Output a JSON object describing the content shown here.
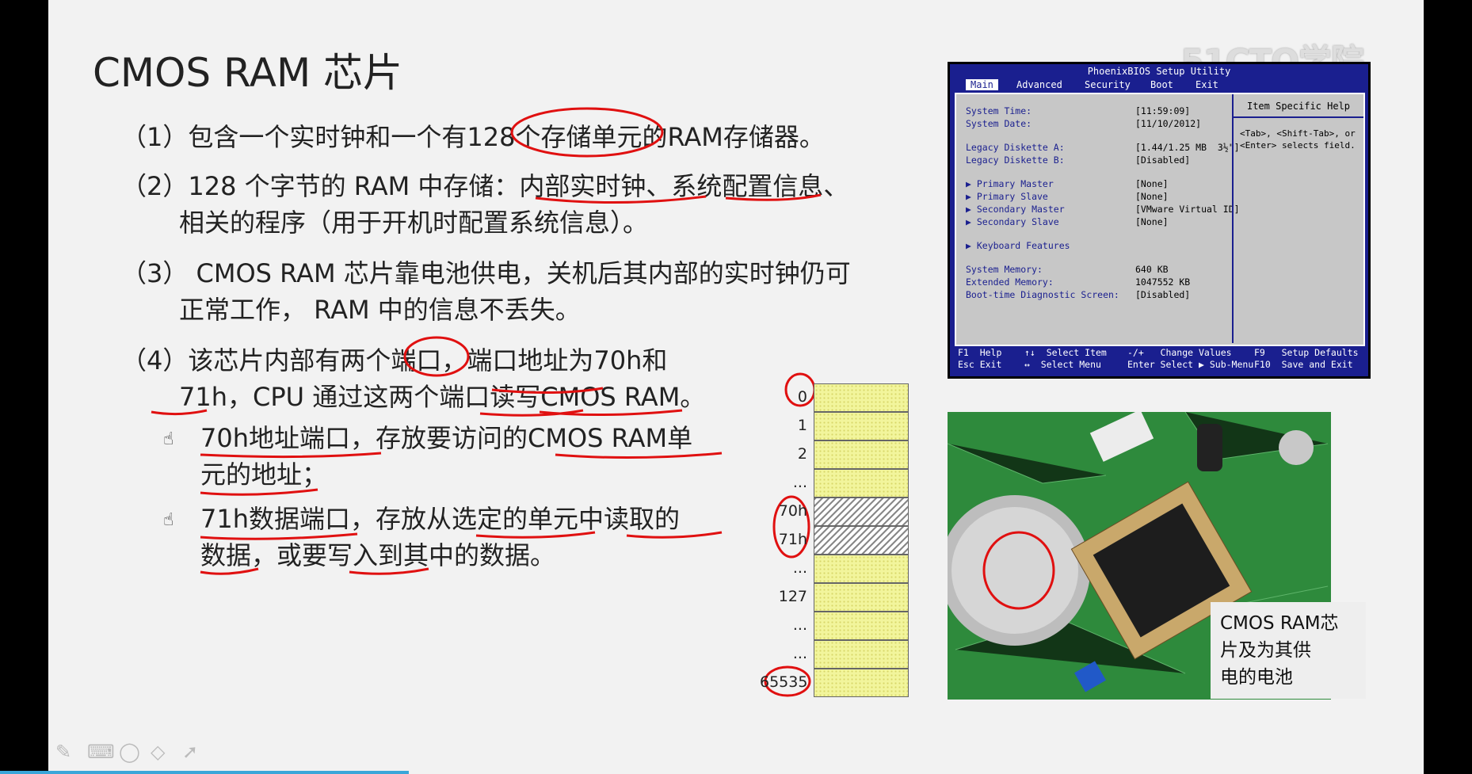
{
  "slide": {
    "title": "CMOS RAM 芯片",
    "watermark": "51CTO学院",
    "p1": "（1）包含一个实时钟和一个有128个存储单元的RAM存储器。",
    "p2a": "（2）128 个字节的 RAM 中存储：内部实时钟、系统配置信息、",
    "p2b": "相关的程序（用于开机时配置系统信息）。",
    "p3a": "（3） CMOS RAM 芯片靠电池供电，关机后其内部的实时钟仍可",
    "p3b": "正常工作， RAM 中的信息不丢失。",
    "p4a": "（4）该芯片内部有两个端口，端口地址为70h和",
    "p4b": "71h，CPU 通过这两个端口读写CMOS RAM。",
    "b1a": "70h地址端口，存放要访问的CMOS RAM单",
    "b1b": "元的地址；",
    "b2a": "71h数据端口，存放从选定的单元中读取的",
    "b2b": "数据，或要写入到其中的数据。",
    "caption": [
      "CMOS RAM芯",
      "片及为其供",
      "电的电池"
    ]
  },
  "bios": {
    "title": "PhoenixBIOS Setup Utility",
    "menu": [
      "Main",
      "Advanced",
      "Security",
      "Boot",
      "Exit"
    ],
    "rows": [
      {
        "label": "System Time:",
        "value": "[11:59:09]"
      },
      {
        "label": "System Date:",
        "value": "[11/10/2012]"
      },
      {
        "label": "Legacy Diskette A:",
        "value": "[1.44/1.25 MB  3½\"]"
      },
      {
        "label": "Legacy Diskette B:",
        "value": "[Disabled]"
      },
      {
        "label": "▶ Primary Master",
        "value": "[None]"
      },
      {
        "label": "▶ Primary Slave",
        "value": "[None]"
      },
      {
        "label": "▶ Secondary Master",
        "value": "[VMware Virtual ID]"
      },
      {
        "label": "▶ Secondary Slave",
        "value": "[None]"
      },
      {
        "label": "▶ Keyboard Features",
        "value": ""
      },
      {
        "label": "System Memory:",
        "value": "640 KB"
      },
      {
        "label": "Extended Memory:",
        "value": "1047552 KB"
      },
      {
        "label": "Boot-time Diagnostic Screen:",
        "value": "[Disabled]"
      }
    ],
    "help_title": "Item Specific Help",
    "help_text": [
      "<Tab>, <Shift-Tab>, or",
      "<Enter> selects field."
    ],
    "footer": {
      "f1": "F1  Help",
      "esc": "Esc Exit",
      "sel_item": "↑↓  Select Item",
      "sel_menu": "↔  Select Menu",
      "chg": "-/+   Change Values",
      "enter": "Enter Select ▶ Sub-Menu",
      "f9": "F9   Setup Defaults",
      "f10": "F10  Save and Exit"
    }
  },
  "memory": {
    "labels": [
      "0",
      "1",
      "2",
      "...",
      "70h",
      "71h",
      "...",
      "127",
      "...",
      "...",
      "65535"
    ]
  },
  "toolbar": [
    "pen-icon",
    "keyboard-icon",
    "lasso-icon",
    "eraser-icon",
    "pointer-icon"
  ]
}
